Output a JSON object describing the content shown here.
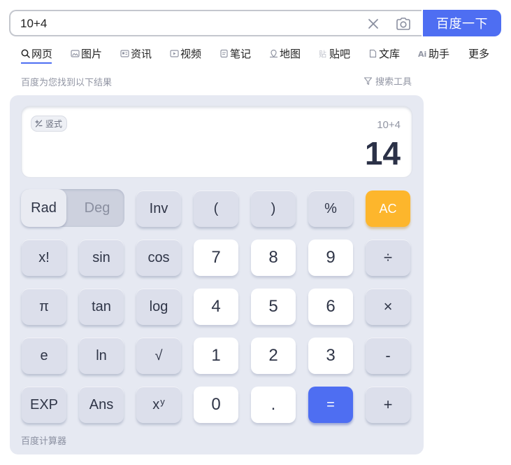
{
  "search": {
    "query": "10+4",
    "button_label": "百度一下"
  },
  "tabs": [
    {
      "label": "网页",
      "icon": "search-icon",
      "active": true
    },
    {
      "label": "图片",
      "icon": "image-icon"
    },
    {
      "label": "资讯",
      "icon": "news-icon"
    },
    {
      "label": "视频",
      "icon": "video-icon"
    },
    {
      "label": "笔记",
      "icon": "note-icon"
    },
    {
      "label": "地图",
      "icon": "map-icon"
    },
    {
      "label": "贴吧",
      "icon": "tieba-icon"
    },
    {
      "label": "文库",
      "icon": "doc-icon"
    },
    {
      "label": "助手",
      "icon": "ai-icon"
    },
    {
      "label": "更多"
    }
  ],
  "results": {
    "hint": "百度为您找到以下结果",
    "tools_label": "搜索工具"
  },
  "calculator": {
    "mode_label": "竖式",
    "expression": "10+4",
    "result": "14",
    "angle": {
      "rad": "Rad",
      "deg": "Deg",
      "selected": "Rad"
    },
    "keys": {
      "inv": "Inv",
      "lparen": "(",
      "rparen": ")",
      "percent": "%",
      "ac": "AC",
      "fact": "x!",
      "sin": "sin",
      "cos": "cos",
      "pi": "π",
      "tan": "tan",
      "log": "log",
      "e": "e",
      "ln": "ln",
      "sqrt": "√",
      "exp": "EXP",
      "ans": "Ans",
      "pow_base": "x",
      "pow_exp": "y",
      "n7": "7",
      "n8": "8",
      "n9": "9",
      "n4": "4",
      "n5": "5",
      "n6": "6",
      "n1": "1",
      "n2": "2",
      "n3": "3",
      "n0": "0",
      "dot": ".",
      "equals": "=",
      "divide": "÷",
      "multiply": "×",
      "minus": "-",
      "plus": "+"
    },
    "footer": "百度计算器"
  },
  "colors": {
    "accent": "#4e6ef2",
    "clear_key": "#fdb62c",
    "panel": "#e6e9f2"
  }
}
